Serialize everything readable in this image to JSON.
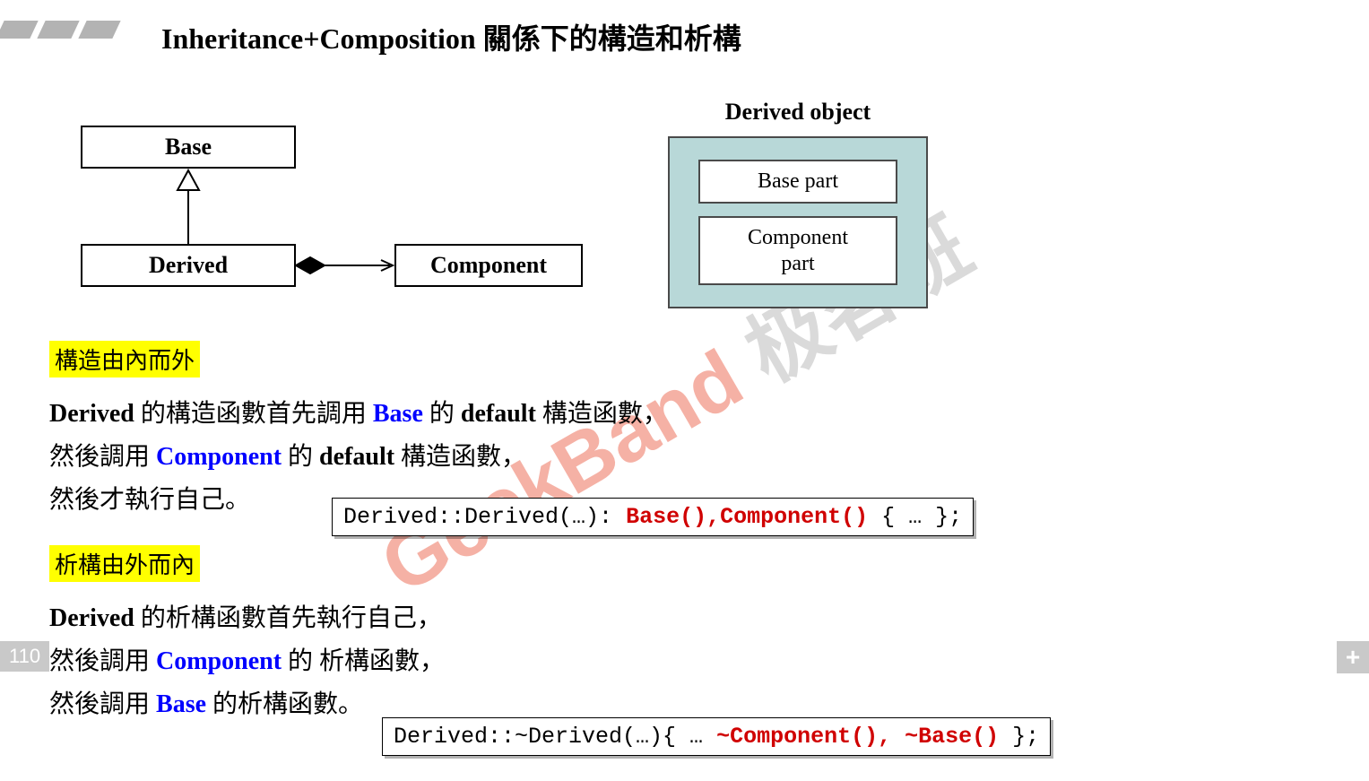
{
  "title": "Inheritance+Composition 關係下的構造和析構",
  "uml": {
    "base": "Base",
    "derived": "Derived",
    "component": "Component"
  },
  "object": {
    "title": "Derived object",
    "base_part": "Base part",
    "component_part": "Component part"
  },
  "watermark": {
    "red": "GeekBand",
    "grey": "极客班"
  },
  "section1": {
    "heading": "構造由內而外",
    "line1_a": "Derived",
    "line1_b": " 的構造函數首先調用 ",
    "line1_c": "Base",
    "line1_d": " 的 ",
    "line1_e": "default",
    "line1_f": " 構造函數，",
    "line2_a": "然後調用 ",
    "line2_b": "Component",
    "line2_c": " 的 ",
    "line2_d": "default",
    "line2_e": " 構造函數，",
    "line3": "然後才執行自己。"
  },
  "code1": {
    "pre": "Derived::Derived(…): ",
    "red": "Base(),Component()",
    "post": " { … };"
  },
  "section2": {
    "heading": "析構由外而內",
    "line1_a": "Derived",
    "line1_b": " 的析構函數首先執行自己，",
    "line2_a": "然後調用 ",
    "line2_b": "Component",
    "line2_c": " 的 析構函數，",
    "line3_a": "然後調用 ",
    "line3_b": "Base",
    "line3_c": " 的析構函數。"
  },
  "code2": {
    "pre": "Derived::~Derived(…){ … ",
    "red": "~Component(), ~Base()",
    "post": " };"
  },
  "page_number": "110",
  "plus": "+"
}
